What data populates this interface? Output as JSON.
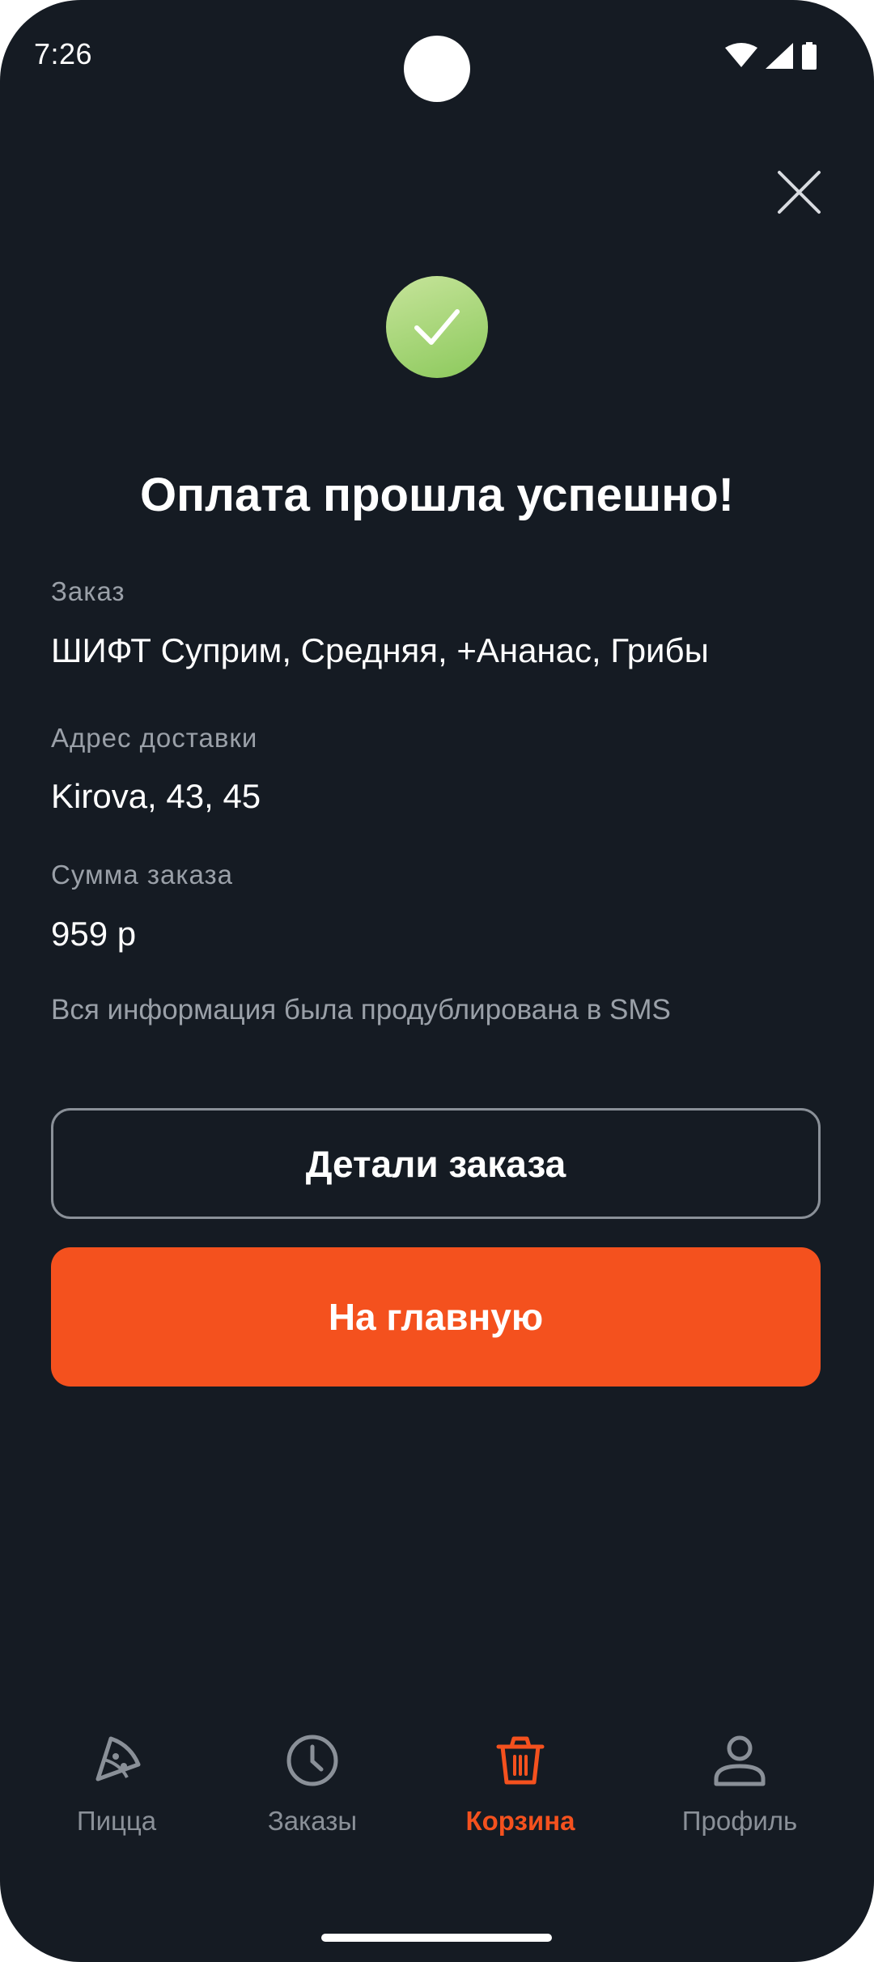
{
  "status_bar": {
    "time": "7:26"
  },
  "header": {
    "close_icon": "close-icon"
  },
  "success": {
    "icon": "check-icon",
    "color": "#9bd26a",
    "title": "Оплата прошла успешно!"
  },
  "order": {
    "order_label": "Заказ",
    "order_value": "ШИФТ Суприм, Средняя, +Ананас, Грибы",
    "address_label": "Адрес доставки",
    "address_value": "Kirova, 43, 45",
    "sum_label": "Сумма заказа",
    "sum_value": "959 р",
    "sms_note": "Вся информация была продублирована в SMS"
  },
  "actions": {
    "details_label": "Детали заказа",
    "home_label": "На главную",
    "accent_color": "#f4511e"
  },
  "bottom_nav": {
    "items": [
      {
        "label": "Пицца",
        "icon": "pizza-icon",
        "active": false
      },
      {
        "label": "Заказы",
        "icon": "clock-icon",
        "active": false
      },
      {
        "label": "Корзина",
        "icon": "basket-icon",
        "active": true
      },
      {
        "label": "Профиль",
        "icon": "profile-icon",
        "active": false
      }
    ]
  }
}
